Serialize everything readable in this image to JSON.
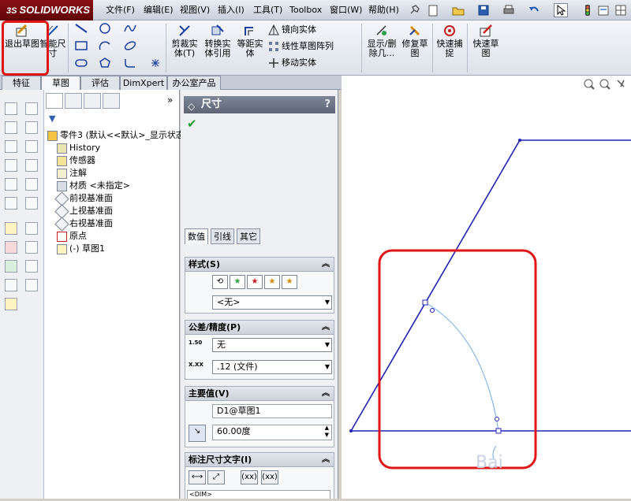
{
  "app": {
    "logo_prefix": "3S",
    "logo_text": "SOLIDWORKS"
  },
  "menu": [
    "文件(F)",
    "编辑(E)",
    "视图(V)",
    "插入(I)",
    "工具(T)",
    "Toolbox",
    "窗口(W)",
    "帮助(H)"
  ],
  "ribbon": {
    "exit_sketch": "退出草图",
    "smart_dim": "智能尺寸",
    "trim": "剪裁实体(T)",
    "convert": "转换实体引用",
    "offset": "等距实体",
    "mirror": "镜向实体",
    "linear_pattern": "线性草图阵列",
    "move": "移动实体",
    "show_delete": "显示/删除几...",
    "repair": "修复草图",
    "quick_snap": "快速捕捉",
    "rapid_sketch": "快速草图"
  },
  "tabs": [
    "特征",
    "草图",
    "评估",
    "DimXpert",
    "办公室产品"
  ],
  "active_tab": 1,
  "tree": {
    "root": "零件3 (默认<<默认>_显示状态",
    "nodes": [
      "History",
      "传感器",
      "注解",
      "材质 <未指定>",
      "前视基准面",
      "上视基准面",
      "右视基准面",
      "原点",
      "(-) 草图1"
    ]
  },
  "prop": {
    "title": "尺寸",
    "help": "?",
    "subtabs": [
      "数值",
      "引线",
      "其它"
    ],
    "style_group": "样式(S)",
    "style_value": "<无>",
    "tol_group": "公差/精度(P)",
    "tol_label_1": "1.50",
    "tol_value": "无",
    "prec_label": "X.XX",
    "prec_value": ".12 (文件)",
    "primary_group": "主要值(V)",
    "primary_name": "D1@草图1",
    "primary_value": "60.00度",
    "dimtext_group": "标注尺寸文字(I)",
    "dim_token": "<DIM>",
    "btn_xx": "(xx)"
  },
  "canvas": {
    "watermark": "Bai"
  }
}
